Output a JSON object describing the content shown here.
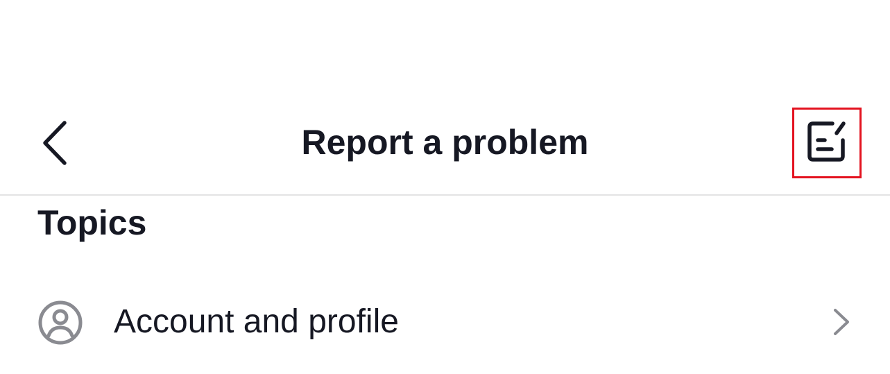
{
  "header": {
    "title": "Report a problem",
    "back_icon": "chevron-left-icon",
    "history_icon": "edit-note-icon",
    "highlight_color": "#e3121f"
  },
  "topics": {
    "heading": "Topics",
    "items": [
      {
        "label": "Account and profile",
        "icon": "person-circle-icon",
        "trailing_icon": "chevron-right-icon"
      }
    ]
  },
  "colors": {
    "text_primary": "#161823",
    "icon_secondary": "#8a8b91",
    "divider": "#e3e3e4",
    "background": "#ffffff"
  }
}
